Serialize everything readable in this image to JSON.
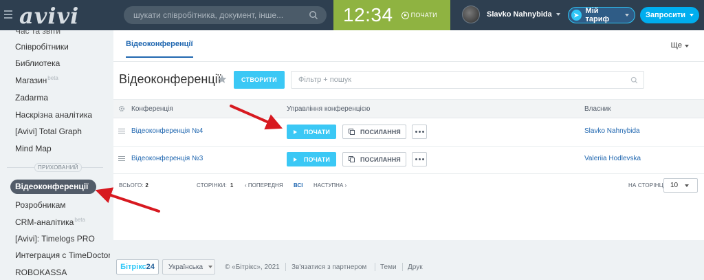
{
  "header": {
    "logo": "avivi",
    "search_placeholder": "шукати співробітника, документ, інше...",
    "clock_time": "12:34",
    "clock_start_label": "ПОЧАТИ",
    "user_name": "Slavko Nahnybida",
    "tariff_label": "Мій тариф",
    "invite_label": "Запросити"
  },
  "sidebar": {
    "cut_item": "Час та звіти",
    "items": [
      "Співробітники",
      "Библиотека",
      "Магазин",
      "Zadarma",
      "Наскрізна аналітика",
      "[Avivi] Total Graph",
      "Mind Map"
    ],
    "shop_badge": "beta",
    "hidden_label": "ПРИХОВАНИЙ",
    "active_item": "Відеоконференції",
    "items_after": [
      "Розробникам",
      "CRM-аналітика",
      "[Avivi]: Timelogs PRO",
      "Интеграция с TimeDoctor",
      "ROBOKASSA"
    ],
    "crm_badge": "beta"
  },
  "main": {
    "tab_active": "Відеоконференції",
    "more_label": "Ще",
    "page_title": "Відеоконференції",
    "create_label": "СТВОРИТИ",
    "filter_placeholder": "Фільтр + пошук",
    "columns": [
      "Конференція",
      "Управління конференцією",
      "Власник"
    ],
    "rows": [
      {
        "name": "Відеоконференція №4",
        "owner": "Slavko Nahnybida"
      },
      {
        "name": "Відеоконференція №3",
        "owner": "Valeriia Hodlevska"
      }
    ],
    "start_label": "ПОЧАТИ",
    "link_label": "ПОСИЛАННЯ",
    "pager": {
      "total_label": "ВСЬОГО:",
      "total_value": "2",
      "pages_label": "СТОРІНКИ:",
      "pages_value": "1",
      "prev_label": "ПОПЕРЕДНЯ",
      "all_label": "ВСІ",
      "next_label": "НАСТУПНА",
      "per_page_label": "НА СТОРІНЦІ:",
      "per_page_value": "10"
    }
  },
  "footer": {
    "b24_text": "Бітрікс",
    "b24_num": "24",
    "language": "Українська",
    "copyright": "© «Бітрікс», 2021",
    "partner_link": "Зв'язатися з партнером",
    "themes_link": "Теми",
    "print_link": "Друк"
  },
  "colors": {
    "header_bg": "#2e3f50",
    "clock_bg": "#8fb341",
    "accent_blue": "#3bc8f5",
    "link_blue": "#2067b0",
    "annotation_red": "#d71920"
  }
}
